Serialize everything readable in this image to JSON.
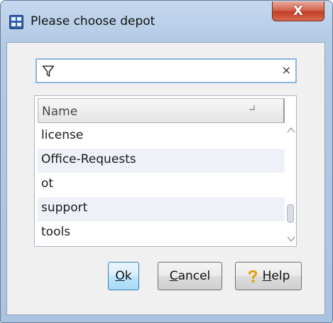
{
  "window": {
    "title": "Please choose depot",
    "close_glyph": "X"
  },
  "filter": {
    "value": "",
    "clear_glyph": "×",
    "icon": "filter-icon"
  },
  "list": {
    "column_header": "Name",
    "sort_indicator": "sort-ascending-icon",
    "items": [
      {
        "label": "license"
      },
      {
        "label": "Office-Requests"
      },
      {
        "label": "ot"
      },
      {
        "label": "support"
      },
      {
        "label": "tools"
      }
    ]
  },
  "buttons": {
    "ok": {
      "mnemonic": "O",
      "rest": "k"
    },
    "cancel": {
      "mnemonic": "C",
      "rest": "ancel"
    },
    "help": {
      "mnemonic": "H",
      "rest": "elp",
      "icon": "help-icon"
    }
  },
  "colors": {
    "titlebar": "#bcd1ea",
    "close_button": "#c94a33",
    "filter_border": "#8cb6e2",
    "alt_row": "#eef1f7",
    "default_button": "#bee6fd"
  }
}
